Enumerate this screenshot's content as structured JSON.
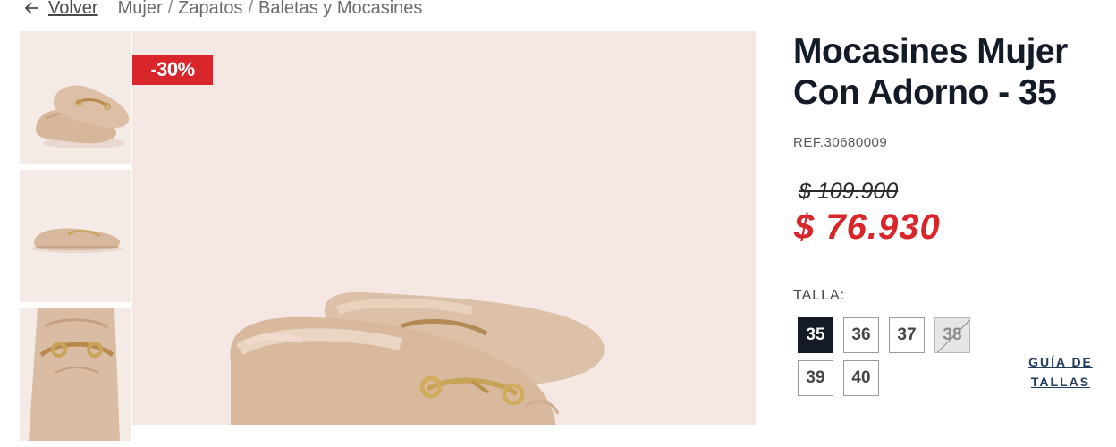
{
  "breadcrumb": {
    "back_label": "Volver",
    "items": [
      "Mujer",
      "Zapatos",
      "Baletas y Mocasines"
    ],
    "separator": "/"
  },
  "product": {
    "badge": "-30%",
    "title": "Mocasines Mujer Con Adorno - 35",
    "ref": "REF.30680009",
    "old_price": "$ 109.900",
    "price": "$ 76.930"
  },
  "sizes": {
    "label": "TALLA:",
    "options": [
      {
        "label": "35",
        "state": "selected"
      },
      {
        "label": "36",
        "state": "available"
      },
      {
        "label": "37",
        "state": "available"
      },
      {
        "label": "38",
        "state": "unavailable"
      },
      {
        "label": "39",
        "state": "available"
      },
      {
        "label": "40",
        "state": "available"
      }
    ],
    "guide_label": "GUÍA DE TALLAS"
  },
  "icons": {
    "back": "arrow-left-icon"
  },
  "colors": {
    "accent": "#d9262b",
    "dark": "#141a26",
    "photo_bg": "#f5e8e4",
    "shoe": "#d8b9a0",
    "hardware": "#c8a45a"
  }
}
